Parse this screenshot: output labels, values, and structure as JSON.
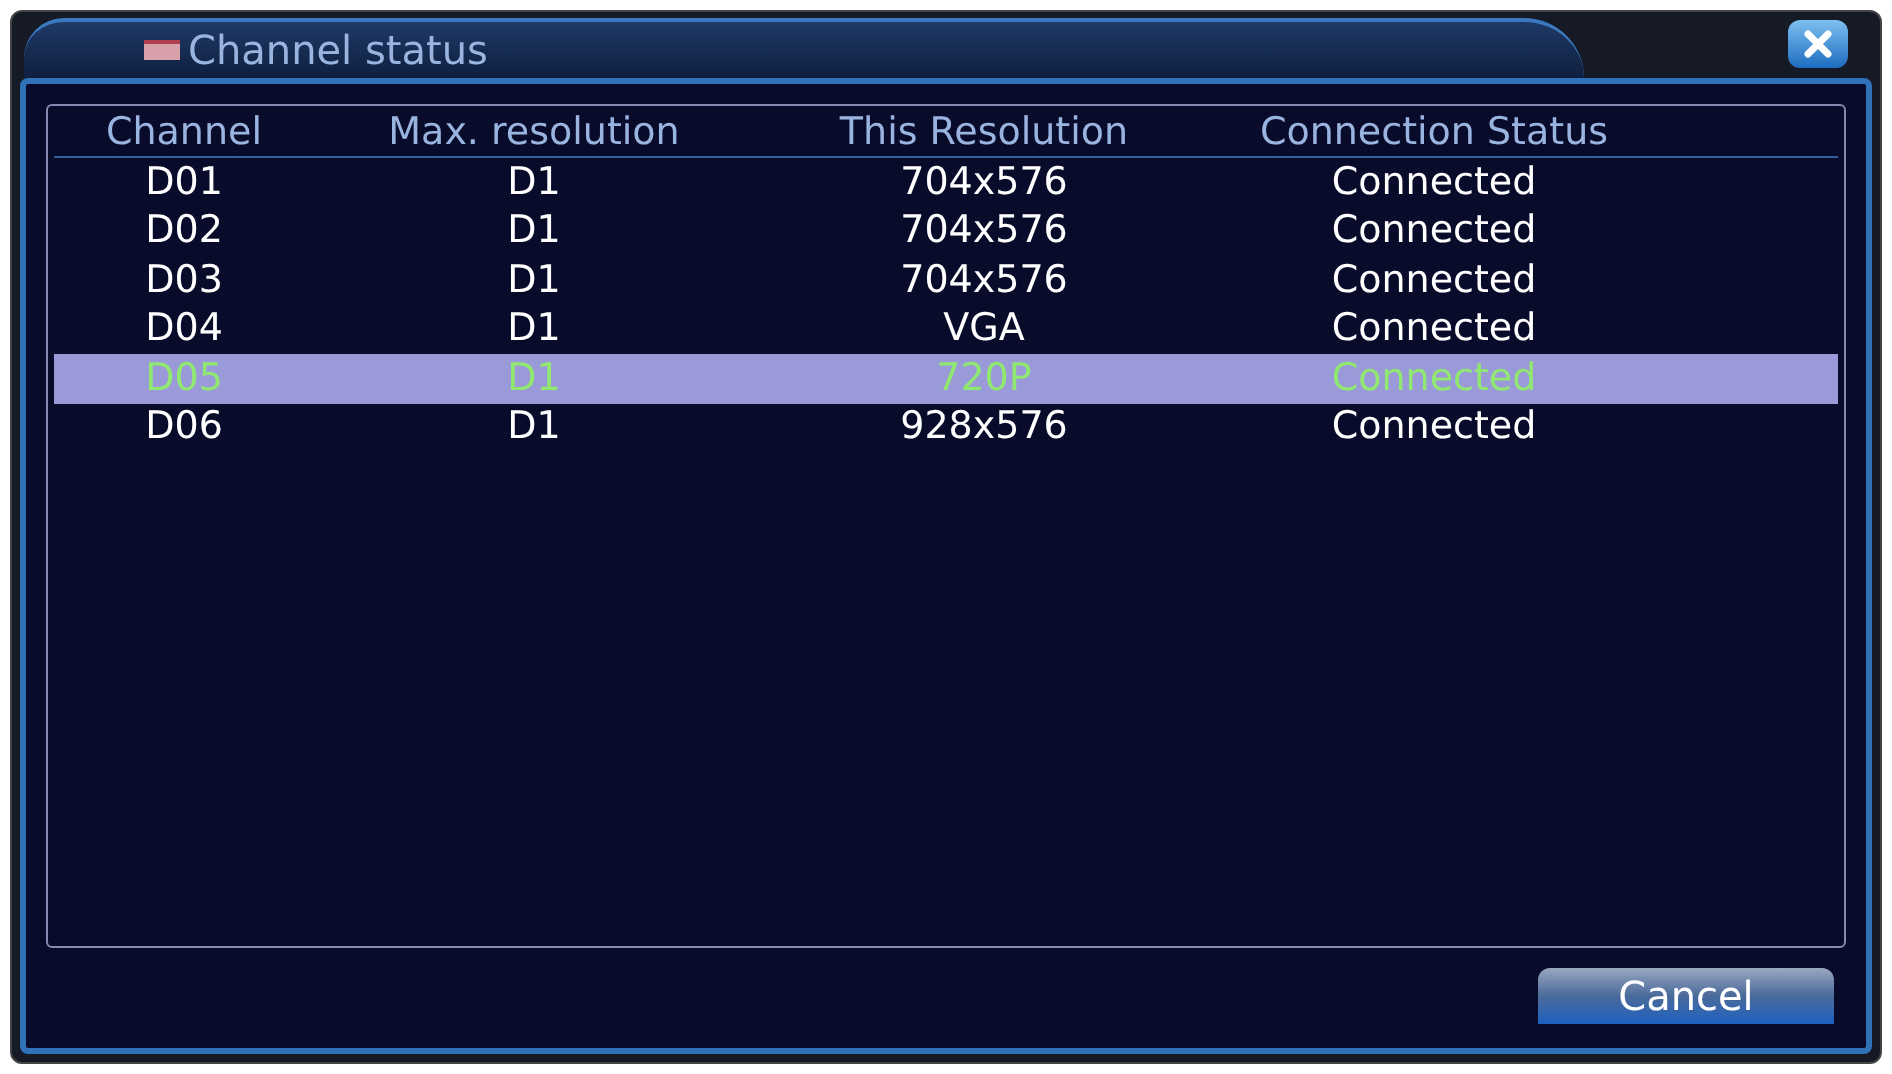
{
  "window": {
    "title": "Channel status"
  },
  "table": {
    "columns": [
      "Channel",
      "Max. resolution",
      "This Resolution",
      "Connection Status"
    ],
    "rows": [
      {
        "cells": [
          "D01",
          "D1",
          "704x576",
          "Connected"
        ],
        "selected": false
      },
      {
        "cells": [
          "D02",
          "D1",
          "704x576",
          "Connected"
        ],
        "selected": false
      },
      {
        "cells": [
          "D03",
          "D1",
          "704x576",
          "Connected"
        ],
        "selected": false
      },
      {
        "cells": [
          "D04",
          "D1",
          "VGA",
          "Connected"
        ],
        "selected": false
      },
      {
        "cells": [
          "D05",
          "D1",
          "720P",
          "Connected"
        ],
        "selected": true
      },
      {
        "cells": [
          "D06",
          "D1",
          "928x576",
          "Connected"
        ],
        "selected": false
      }
    ]
  },
  "buttons": [
    "Cancel"
  ]
}
